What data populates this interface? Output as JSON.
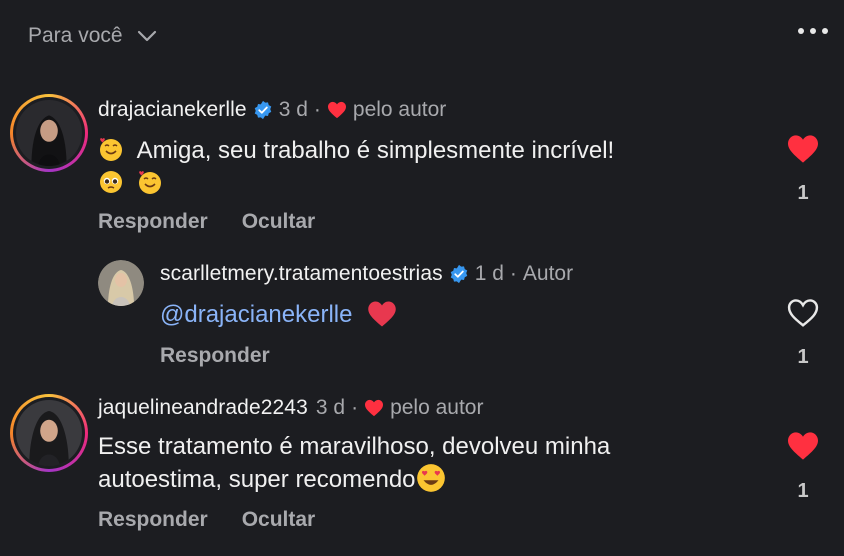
{
  "header": {
    "filter_label": "Para você"
  },
  "comments": [
    {
      "username": "drajacianekerlle",
      "time": "3 d",
      "separator": "·",
      "byauthor": "pelo autor",
      "text": "Amiga, seu trabalho é simplesmente incrível!",
      "reply_label": "Responder",
      "hide_label": "Ocultar",
      "likes": "1",
      "liked": true
    },
    {
      "username": "scarlletmery.tratamentoestrias",
      "time": "1 d",
      "separator": "·",
      "author_tag": "Autor",
      "mention": "@drajacianekerlle",
      "reply_label": "Responder",
      "likes": "1",
      "liked": false
    },
    {
      "username": "jaquelineandrade2243",
      "time": "3 d",
      "separator": "·",
      "byauthor": "pelo autor",
      "text_line1": "Esse tratamento é maravilhoso, devolveu minha",
      "text_line2": "autoestima, super recomendo",
      "reply_label": "Responder",
      "hide_label": "Ocultar",
      "likes": "1",
      "liked": true
    }
  ],
  "colors": {
    "background": "#1c1d21",
    "heart": "#ff3040",
    "verified": "#3797f0",
    "mention": "#8ab4f8"
  }
}
